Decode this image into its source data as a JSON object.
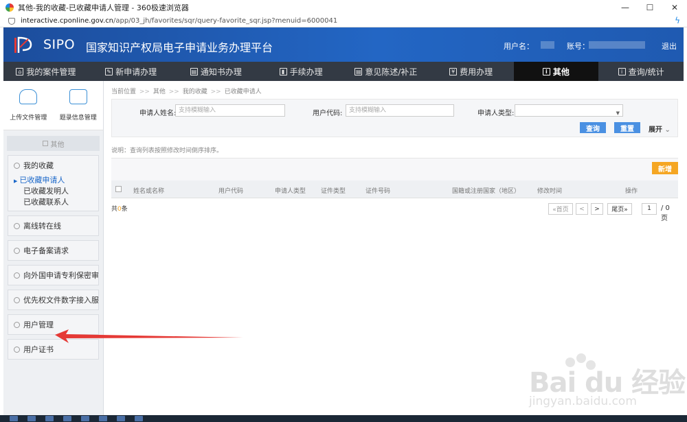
{
  "browser": {
    "title": "其他-我的收藏-已收藏申请人管理 - 360极速浏览器",
    "url_host": "interactive.cponline.gov.cn",
    "url_path": "/app/03_jh/favorites/sqr/query-favorite_sqr.jsp?menuid=6000041",
    "minimize": "—",
    "maximize": "☐",
    "close": "✕",
    "bolt": "ϟ"
  },
  "header": {
    "brand": "SIPO",
    "platform": "国家知识产权局电子申请业务办理平台",
    "user_label": "用户名：",
    "account_label": "账号：",
    "logout": "退出"
  },
  "nav": {
    "items": [
      {
        "label": "我的案件管理",
        "icon": "⌂"
      },
      {
        "label": "新申请办理",
        "icon": "✎"
      },
      {
        "label": "通知书办理",
        "icon": "▤"
      },
      {
        "label": "手续办理",
        "icon": "▮"
      },
      {
        "label": "意见陈述/补正",
        "icon": "▤"
      },
      {
        "label": "费用办理",
        "icon": "¥"
      },
      {
        "label": "其他",
        "icon": "i"
      },
      {
        "label": "查询/统计",
        "icon": "i"
      }
    ]
  },
  "sidebar": {
    "tools": [
      {
        "label": "上传文件管理",
        "icon": "cloud-upload-icon"
      },
      {
        "label": "题录信息管理",
        "icon": "chat-icon"
      }
    ],
    "section_title": "其他",
    "favorites": {
      "label": "我的收藏",
      "items": [
        "已收藏申请人",
        "已收藏发明人",
        "已收藏联系人"
      ]
    },
    "menu": [
      "离线转在线",
      "电子备案请求",
      "向外国申请专利保密审…",
      "优先权文件数字接入服…",
      "用户管理",
      "用户证书"
    ]
  },
  "content": {
    "breadcrumb": [
      "当前位置",
      "其他",
      "我的收藏",
      "已收藏申请人"
    ],
    "breadcrumb_sep": ">>",
    "search": {
      "applicant_name_label": "申请人姓名:",
      "applicant_name_placeholder": "支持模糊输入",
      "user_code_label": "用户代码:",
      "user_code_placeholder": "支持模糊输入",
      "applicant_type_label": "申请人类型:",
      "applicant_type_value": "",
      "query_button": "查询",
      "reset_button": "重置",
      "expand": "展开"
    },
    "note": "说明：查询列表按照修改时间倒序排序。",
    "add_button": "新增",
    "columns": [
      "姓名或名称",
      "用户代码",
      "申请人类型",
      "证件类型",
      "证件号码",
      "国籍或注册国家（地区）",
      "修改时间",
      "操作"
    ],
    "total_prefix": "共",
    "total_count": "0",
    "total_suffix": "条",
    "pager": {
      "first": "«首页",
      "prev": "<",
      "next": ">",
      "last": "尾页»",
      "page": "1",
      "total": "/ 0 页"
    }
  },
  "watermark": {
    "text": "Bai du 经验",
    "sub": "jingyan.baidu.com"
  },
  "colors": {
    "header_blue": "#2366c4",
    "nav_dark": "#333a44",
    "accent_orange": "#f5a623",
    "button_blue": "#4a90e2",
    "arrow_red": "#e53935"
  }
}
